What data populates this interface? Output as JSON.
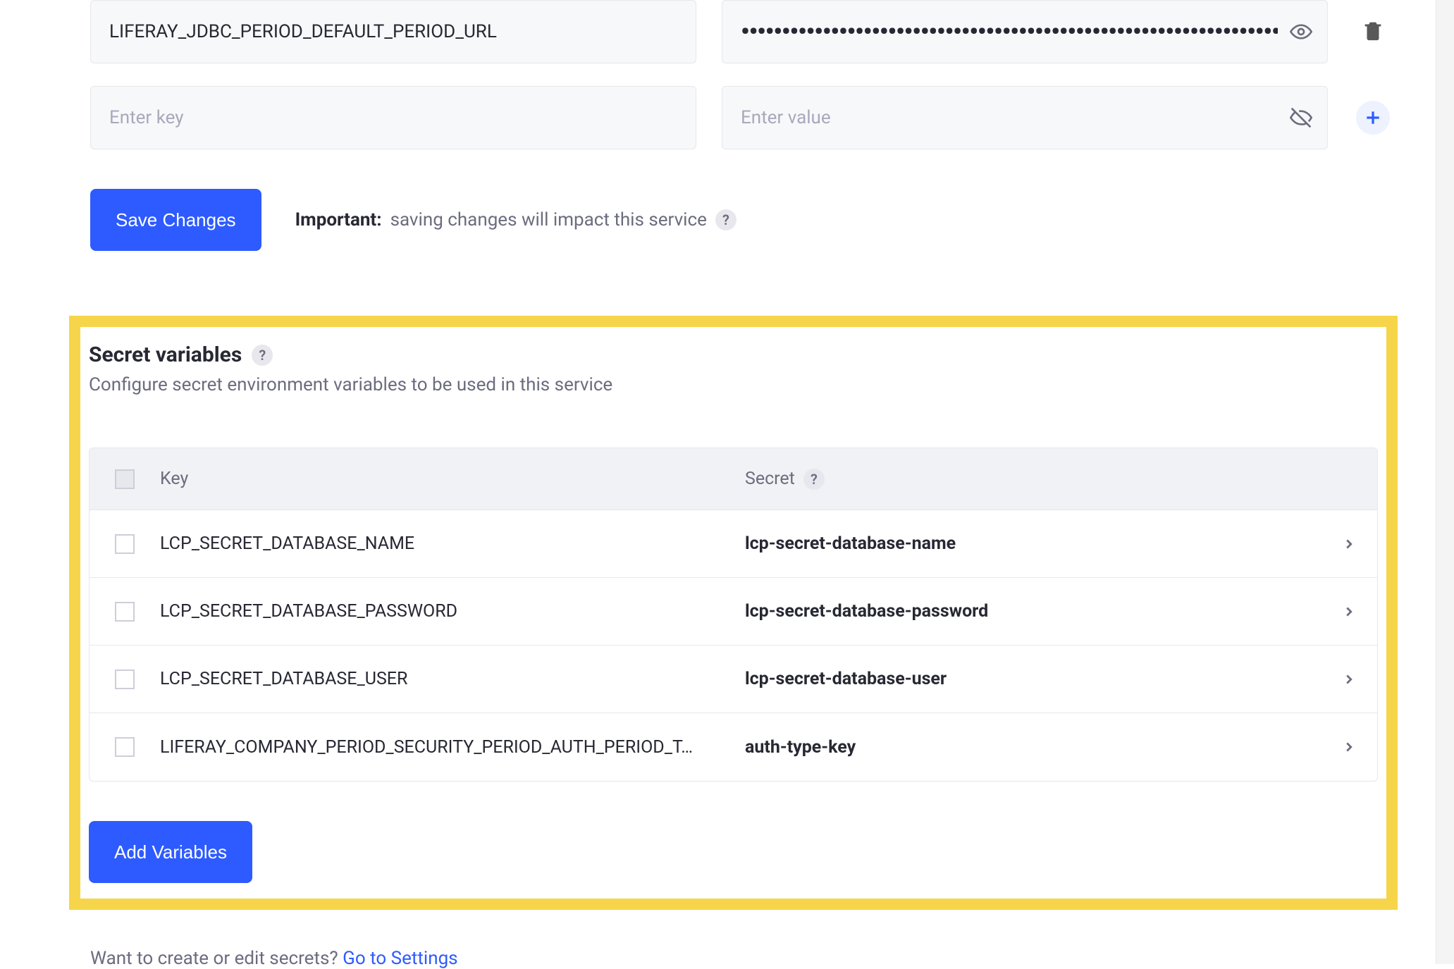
{
  "env_vars": {
    "rows": [
      {
        "key": "LIFERAY_JDBC_PERIOD_DEFAULT_PERIOD_URL",
        "value_masked": "••••••••••••••••••••••••••••••••••••••••••••••••••••••••••••••••••••••••••••••••••••••••••••••••••••••••••••••••••••••••••••••••••••••",
        "is_masked": true,
        "is_new": false
      }
    ],
    "new_row": {
      "key_placeholder": "Enter key",
      "value_placeholder": "Enter value"
    },
    "save_label": "Save Changes",
    "important_label": "Important:",
    "important_text": "saving changes will impact this service"
  },
  "secrets": {
    "heading": "Secret variables",
    "description": "Configure secret environment variables to be used in this service",
    "columns": {
      "key": "Key",
      "secret": "Secret"
    },
    "rows": [
      {
        "key": "LCP_SECRET_DATABASE_NAME",
        "secret": "lcp-secret-database-name"
      },
      {
        "key": "LCP_SECRET_DATABASE_PASSWORD",
        "secret": "lcp-secret-database-password"
      },
      {
        "key": "LCP_SECRET_DATABASE_USER",
        "secret": "lcp-secret-database-user"
      },
      {
        "key": "LIFERAY_COMPANY_PERIOD_SECURITY_PERIOD_AUTH_PERIOD_T…",
        "secret": "auth-type-key"
      }
    ],
    "add_label": "Add Variables"
  },
  "footer": {
    "text": "Want to create or edit secrets? ",
    "link_text": "Go to Settings"
  },
  "help_glyph": "?"
}
